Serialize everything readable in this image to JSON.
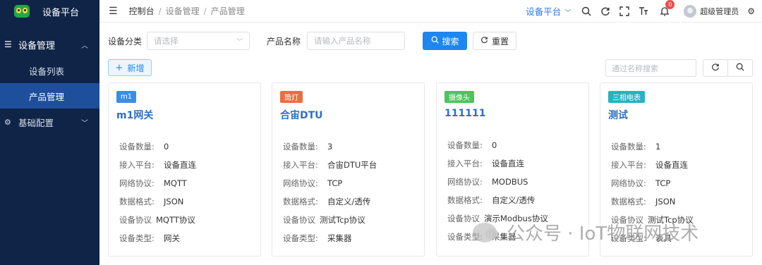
{
  "app": {
    "title": "设备平台"
  },
  "sidebar": {
    "group1": {
      "label": "设备管理",
      "icon": "list-icon"
    },
    "items": [
      {
        "label": "设备列表"
      },
      {
        "label": "产品管理"
      }
    ],
    "group2": {
      "label": "基础配置",
      "icon": "gear-icon"
    }
  },
  "header": {
    "breadcrumb": [
      "控制台",
      "设备管理",
      "产品管理"
    ],
    "platform_label": "设备平台",
    "notification_count": "0",
    "username": "超级管理员"
  },
  "filter": {
    "category_label": "设备分类",
    "category_placeholder": "请选择",
    "name_label": "产品名称",
    "name_placeholder": "请输入产品名称",
    "search_label": "搜索",
    "reset_label": "重置"
  },
  "toolbar": {
    "add_label": "新增",
    "search_placeholder": "通过名称搜索"
  },
  "cards": [
    {
      "tag": "m1",
      "tag_color": "#3a8ee6",
      "title": "m1网关",
      "fields": [
        {
          "label": "设备数量:",
          "value": "0"
        },
        {
          "label": "接入平台:",
          "value": "设备直连"
        },
        {
          "label": "网络协议:",
          "value": "MQTT"
        },
        {
          "label": "数据格式:",
          "value": "JSON"
        },
        {
          "label": "设备协议",
          "value": "MQTT协议"
        },
        {
          "label": "设备类型:",
          "value": "网关"
        }
      ]
    },
    {
      "tag": "筒灯",
      "tag_color": "#ee6d3f",
      "title": "合宙DTU",
      "fields": [
        {
          "label": "设备数量:",
          "value": "3"
        },
        {
          "label": "接入平台:",
          "value": "合宙DTU平台"
        },
        {
          "label": "网络协议:",
          "value": "TCP"
        },
        {
          "label": "数据格式:",
          "value": "自定义/透传"
        },
        {
          "label": "设备协议",
          "value": "测试Tcp协议"
        },
        {
          "label": "设备类型:",
          "value": "采集器"
        }
      ]
    },
    {
      "tag": "摄像头",
      "tag_color": "#4cc45a",
      "title": "111111",
      "fields": [
        {
          "label": "设备数量:",
          "value": "0"
        },
        {
          "label": "接入平台:",
          "value": "设备直连"
        },
        {
          "label": "网络协议:",
          "value": "MODBUS"
        },
        {
          "label": "数据格式:",
          "value": "自定义/透传"
        },
        {
          "label": "设备协议",
          "value": "演示Modbus协议"
        },
        {
          "label": "设备类型:",
          "value": "采集器"
        }
      ]
    },
    {
      "tag": "三相电表",
      "tag_color": "#26b3c3",
      "title": "测试",
      "fields": [
        {
          "label": "设备数量:",
          "value": "1"
        },
        {
          "label": "接入平台:",
          "value": "设备直连"
        },
        {
          "label": "网络协议:",
          "value": "TCP"
        },
        {
          "label": "数据格式:",
          "value": "JSON"
        },
        {
          "label": "设备协议",
          "value": "测试Tcp协议"
        },
        {
          "label": "设备类型:",
          "value": "表具"
        }
      ]
    }
  ],
  "watermark": "公众号 · IoT物联网技术"
}
